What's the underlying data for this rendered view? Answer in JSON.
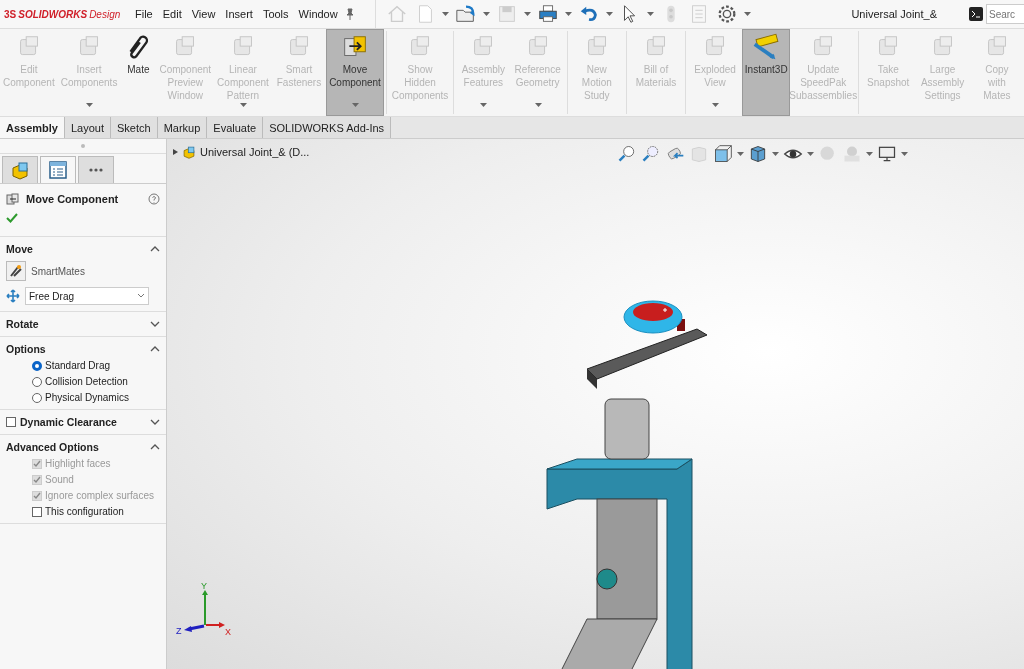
{
  "app": {
    "brand_mark": "3S",
    "brand_bold": "SOLIDWORKS",
    "brand_light": "Design"
  },
  "menu": [
    "File",
    "Edit",
    "View",
    "Insert",
    "Tools",
    "Window"
  ],
  "document_title": "Universal Joint_&",
  "search": {
    "placeholder": "Searc"
  },
  "ribbon_groups": [
    {
      "buttons": [
        {
          "label": "Edit\nComponent",
          "disabled": true,
          "selected": false,
          "dropdown": false
        },
        {
          "label": "Insert\nComponents",
          "disabled": true,
          "selected": false,
          "dropdown": true
        },
        {
          "label": "Mate",
          "disabled": false,
          "selected": false,
          "dropdown": false
        },
        {
          "label": "Component\nPreview\nWindow",
          "disabled": true,
          "selected": false,
          "dropdown": false
        },
        {
          "label": "Linear\nComponent\nPattern",
          "disabled": true,
          "selected": false,
          "dropdown": true
        },
        {
          "label": "Smart\nFasteners",
          "disabled": true,
          "selected": false,
          "dropdown": false
        },
        {
          "label": "Move\nComponent",
          "disabled": false,
          "selected": true,
          "dropdown": true
        }
      ]
    },
    {
      "buttons": [
        {
          "label": "Show\nHidden\nComponents",
          "disabled": true,
          "selected": false,
          "dropdown": false
        }
      ]
    },
    {
      "buttons": [
        {
          "label": "Assembly\nFeatures",
          "disabled": true,
          "selected": false,
          "dropdown": true
        },
        {
          "label": "Reference\nGeometry",
          "disabled": true,
          "selected": false,
          "dropdown": true
        }
      ]
    },
    {
      "buttons": [
        {
          "label": "New\nMotion\nStudy",
          "disabled": true,
          "selected": false,
          "dropdown": false
        }
      ]
    },
    {
      "buttons": [
        {
          "label": "Bill of\nMaterials",
          "disabled": true,
          "selected": false,
          "dropdown": false
        }
      ]
    },
    {
      "buttons": [
        {
          "label": "Exploded\nView",
          "disabled": true,
          "selected": false,
          "dropdown": true
        },
        {
          "label": "Instant3D",
          "disabled": false,
          "selected": true,
          "dropdown": false
        },
        {
          "label": "Update\nSpeedPak\nSubassemblies",
          "disabled": true,
          "selected": false,
          "dropdown": false
        }
      ]
    },
    {
      "buttons": [
        {
          "label": "Take\nSnapshot",
          "disabled": true,
          "selected": false,
          "dropdown": false
        },
        {
          "label": "Large\nAssembly\nSettings",
          "disabled": true,
          "selected": false,
          "dropdown": false
        },
        {
          "label": "Copy\nwith\nMates",
          "disabled": true,
          "selected": false,
          "dropdown": false
        }
      ]
    }
  ],
  "tabs": [
    {
      "label": "Assembly",
      "selected": true
    },
    {
      "label": "Layout",
      "selected": false
    },
    {
      "label": "Sketch",
      "selected": false
    },
    {
      "label": "Markup",
      "selected": false
    },
    {
      "label": "Evaluate",
      "selected": false
    },
    {
      "label": "SOLIDWORKS Add-Ins",
      "selected": false
    }
  ],
  "panel_tabs": [
    {
      "kind": "tree",
      "selected": false
    },
    {
      "kind": "property",
      "selected": true
    },
    {
      "kind": "more",
      "selected": false
    }
  ],
  "property_manager": {
    "title": "Move Component",
    "sections": [
      {
        "title": "Move",
        "expanded": true,
        "kind": "move",
        "smartmates": "SmartMates",
        "dropdown_value": "Free Drag"
      },
      {
        "title": "Rotate",
        "expanded": false,
        "kind": "plain"
      },
      {
        "title": "Options",
        "expanded": true,
        "kind": "radios",
        "options": [
          {
            "label": "Standard Drag",
            "selected": true
          },
          {
            "label": "Collision Detection",
            "selected": false
          },
          {
            "label": "Physical Dynamics",
            "selected": false
          }
        ]
      },
      {
        "title": "Dynamic Clearance",
        "expanded": false,
        "kind": "check_header",
        "checked": false
      },
      {
        "title": "Advanced Options",
        "expanded": true,
        "kind": "checks",
        "options": [
          {
            "label": "Highlight faces",
            "checked": true,
            "disabled": true
          },
          {
            "label": "Sound",
            "checked": true,
            "disabled": true
          },
          {
            "label": "Ignore complex surfaces",
            "checked": true,
            "disabled": true
          },
          {
            "label": "This configuration",
            "checked": false,
            "disabled": false
          }
        ]
      }
    ]
  },
  "tree_root": {
    "label": "Universal Joint_& (D...",
    "expanded": false
  },
  "triad": {
    "x": "X",
    "y": "Y",
    "z": "Z"
  }
}
